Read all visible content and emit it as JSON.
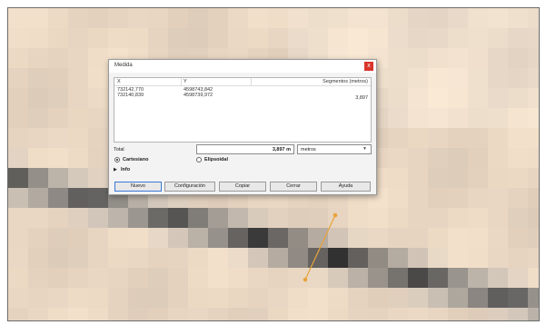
{
  "dialog": {
    "title": "Medida",
    "close_glyph": "x",
    "close_icon": "close-icon"
  },
  "table": {
    "columns": [
      "X",
      "Y",
      "Segmentos (metros)"
    ],
    "rows": [
      [
        "732142,770",
        "4598743,842",
        ""
      ],
      [
        "732140,839",
        "4598739,972",
        "3,897"
      ]
    ]
  },
  "total": {
    "label": "Total",
    "value": "3,897 m",
    "units_selected": "metros",
    "dropdown_glyph": "▼"
  },
  "modes": [
    {
      "label": "Cartesiano",
      "checked": true
    },
    {
      "label": "Elipsoidal",
      "checked": false
    }
  ],
  "info": {
    "toggle_glyph": "▶",
    "label": "Info"
  },
  "buttons": {
    "new": "Nuevo",
    "config": "Configuración",
    "copy": "Copiar",
    "close": "Cerrar",
    "help": "Ayuda"
  },
  "colors": {
    "map_background": "#e9d8c5",
    "measure_line": "#e8a33a",
    "close_button": "#d9342b"
  }
}
